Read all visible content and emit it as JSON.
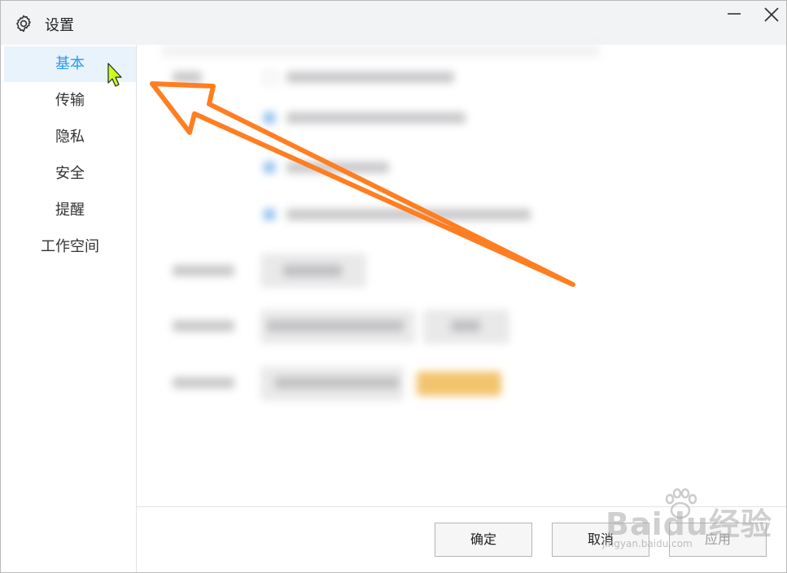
{
  "window": {
    "title": "设置",
    "icons": {
      "settings": "gear-icon",
      "minimize": "minimize-icon",
      "close": "close-icon"
    }
  },
  "sidebar": {
    "items": [
      {
        "label": "基本",
        "active": true
      },
      {
        "label": "传输",
        "active": false
      },
      {
        "label": "隐私",
        "active": false
      },
      {
        "label": "安全",
        "active": false
      },
      {
        "label": "提醒",
        "active": false
      },
      {
        "label": "工作空间",
        "active": false
      }
    ]
  },
  "footer": {
    "confirm_label": "确定",
    "cancel_label": "取消",
    "apply_label": "应用"
  },
  "annotation": {
    "arrow_color": "#ff7e21",
    "cursor_color": "#c8ff1e"
  },
  "watermark": {
    "brand": "Baidu经验",
    "url": "jingyan.baidu.com"
  },
  "colors": {
    "accent": "#2c9af0",
    "active_bg": "#e8f3fc"
  }
}
